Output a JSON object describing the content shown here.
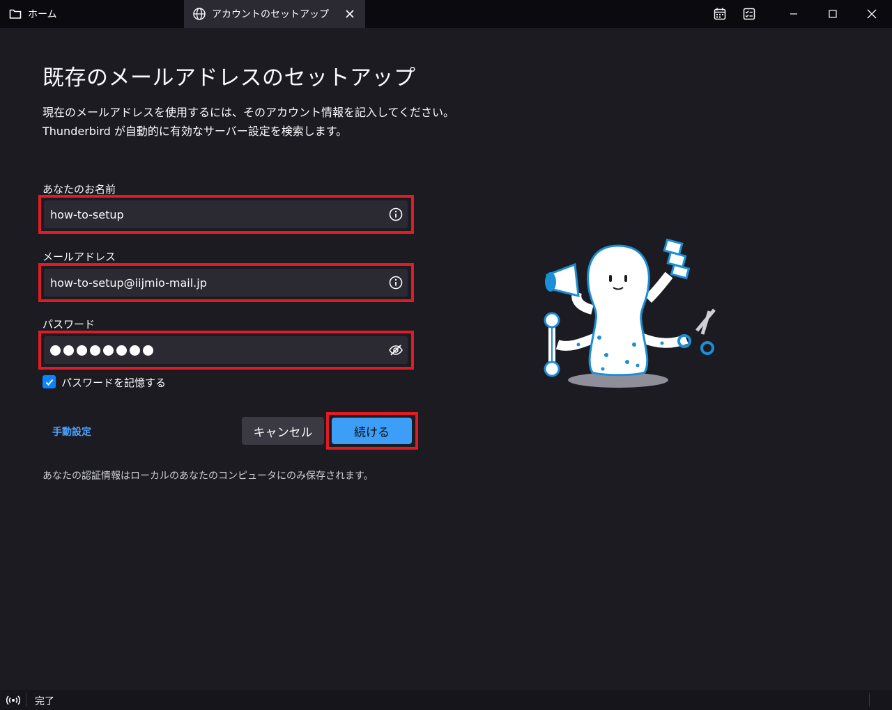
{
  "tabs": [
    {
      "label": "ホーム",
      "icon": "folder-icon"
    },
    {
      "label": "アカウントのセットアップ",
      "icon": "globe-icon"
    }
  ],
  "toolbar": {
    "calendar_icon": "calendar-icon",
    "tasks_icon": "tasks-icon"
  },
  "window_controls": [
    "minimize",
    "maximize",
    "close"
  ],
  "page": {
    "title": "既存のメールアドレスのセットアップ",
    "intro_line1": "現在のメールアドレスを使用するには、そのアカウント情報を記入してください。",
    "intro_line2": "Thunderbird が自動的に有効なサーバー設定を検索します。"
  },
  "form": {
    "name_label": "あなたのお名前",
    "name_value": "how-to-setup",
    "email_label": "メールアドレス",
    "email_value": "how-to-setup@iijmio-mail.jp",
    "password_label": "パスワード",
    "password_mask_count": 8,
    "remember_label": "パスワードを記憶する",
    "remember_checked": true
  },
  "actions": {
    "manual_label": "手動設定",
    "cancel_label": "キャンセル",
    "continue_label": "続ける"
  },
  "note": "あなたの認証情報はローカルのあなたのコンピュータにのみ保存されます。",
  "status": {
    "text": "完了",
    "icon": "broadcast-icon"
  },
  "colors": {
    "highlight": "#e01b24",
    "accent": "#3d9ef7",
    "background": "#1c1b22",
    "field": "#2b2a33"
  }
}
